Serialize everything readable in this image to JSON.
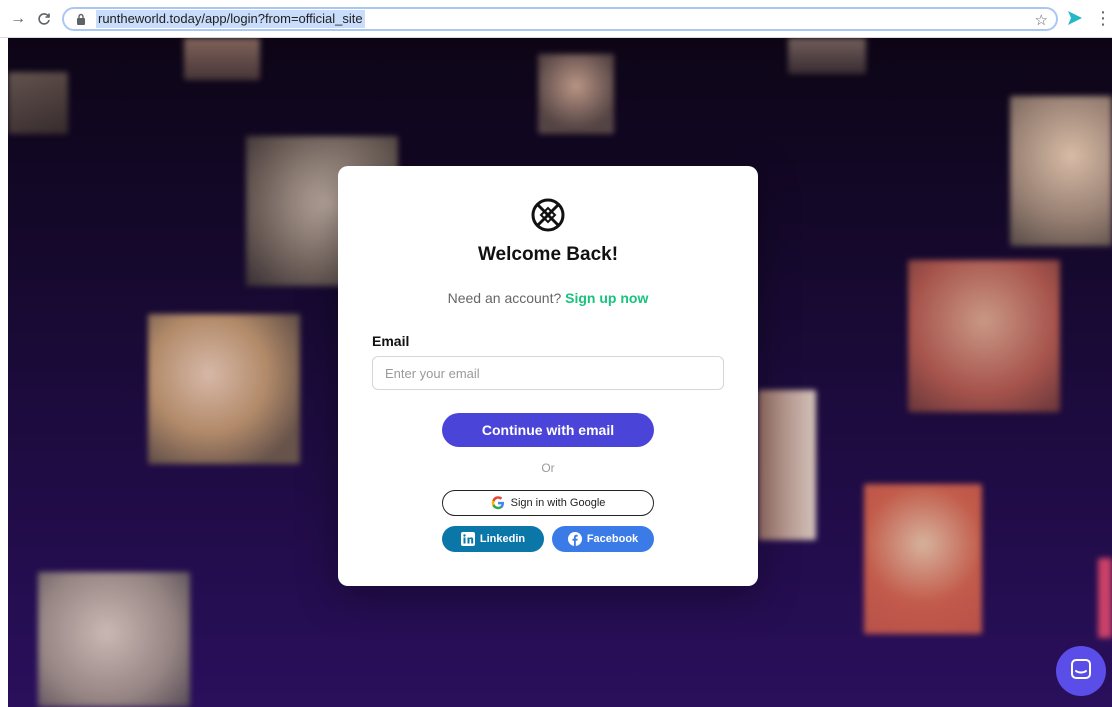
{
  "browser": {
    "url": "runtheworld.today/app/login?from=official_site",
    "back_icon": "arrow-right-icon",
    "reload_icon": "reload-icon"
  },
  "login": {
    "title": "Welcome Back!",
    "signup_prompt": "Need an account?",
    "signup_link": "Sign up now",
    "email_label": "Email",
    "email_placeholder": "Enter your email",
    "continue_button": "Continue with email",
    "or_text": "Or",
    "google_button": "Sign in with Google",
    "linkedin_button": "Linkedin",
    "facebook_button": "Facebook"
  },
  "colors": {
    "primary": "#4a45d8",
    "signup_link": "#19c37d",
    "linkedin": "#0a77a8",
    "facebook": "#3b7be8",
    "chat_bubble": "#5b4ee8",
    "background_dark": "#190a36"
  }
}
